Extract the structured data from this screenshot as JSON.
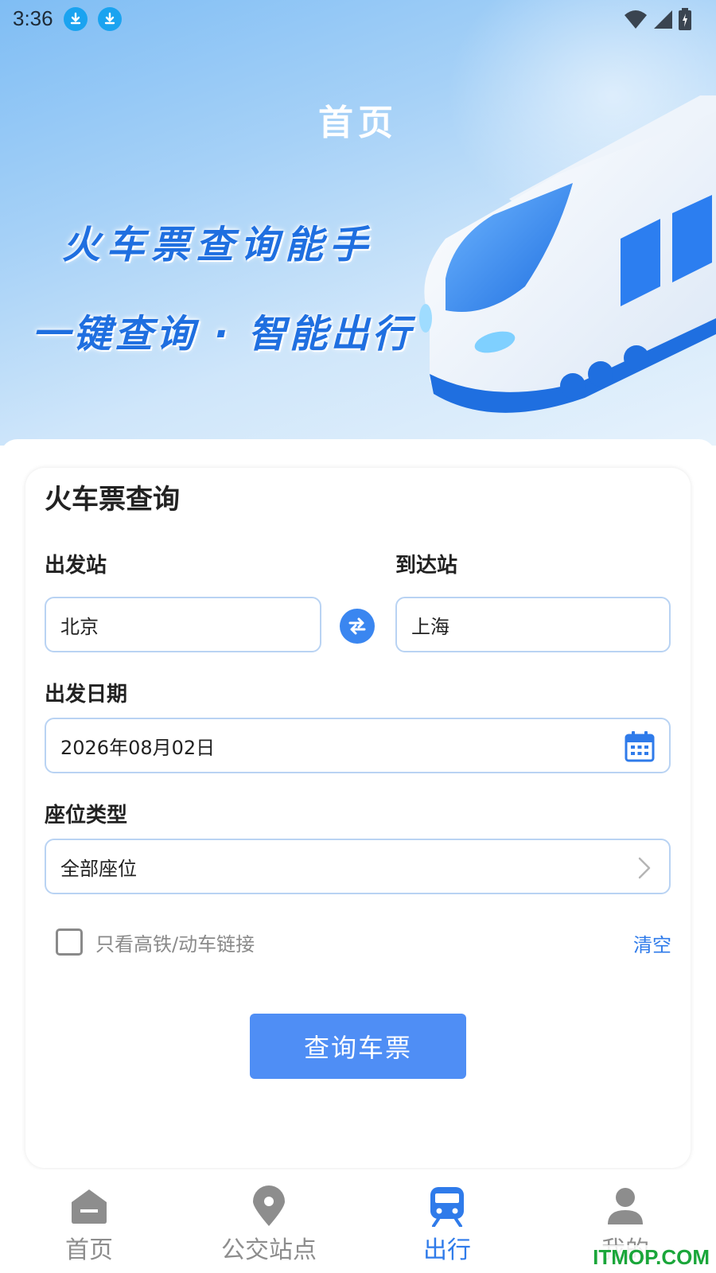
{
  "status_bar": {
    "time": "3:36"
  },
  "hero": {
    "title": "首页",
    "slogan1": "火车票查询能手",
    "slogan2": "一键查询 · 智能出行"
  },
  "form": {
    "title": "火车票查询",
    "from_label": "出发站",
    "from_value": "北京",
    "to_label": "到达站",
    "to_value": "上海",
    "date_label": "出发日期",
    "date_value": "2026年08月02日",
    "seat_label": "座位类型",
    "seat_value": "全部座位",
    "filter_checkbox_label": "只看高铁/动车链接",
    "filter_checked": false,
    "clear_label": "清空",
    "query_button": "查询车票"
  },
  "tabbar": {
    "tabs": [
      {
        "label": "首页",
        "icon": "home-icon",
        "active": false
      },
      {
        "label": "公交站点",
        "icon": "location-pin-icon",
        "active": false
      },
      {
        "label": "出行",
        "icon": "train-icon",
        "active": true
      },
      {
        "label": "我的",
        "icon": "person-icon",
        "active": false
      }
    ]
  },
  "watermark": "ITMOP.COM",
  "colors": {
    "accent": "#4f8ef5",
    "link": "#2f7bea",
    "field_border": "#b9d3f3",
    "inactive_tab": "#8d8d8d"
  }
}
